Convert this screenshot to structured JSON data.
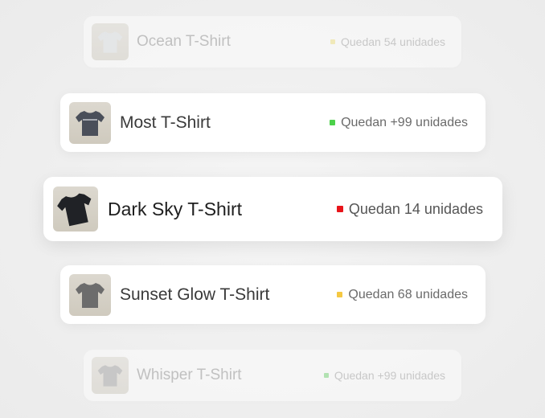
{
  "products": [
    {
      "name": "Ocean T-Shirt",
      "stock_text": "Quedan 54 unidades",
      "status_color": "#f2e27a",
      "shirt_color": "#d9dde0",
      "icon": "t-shirt-icon"
    },
    {
      "name": "Most T-Shirt",
      "stock_text": "Quedan +99 unidades",
      "status_color": "#4cd14a",
      "shirt_color": "#4a4f5a",
      "icon": "t-shirt-icon"
    },
    {
      "name": "Dark Sky T-Shirt",
      "stock_text": "Quedan 14 unidades",
      "status_color": "#e8141a",
      "shirt_color": "#202226",
      "icon": "t-shirt-icon"
    },
    {
      "name": "Sunset Glow T-Shirt",
      "stock_text": "Quedan 68 unidades",
      "status_color": "#f5c842",
      "shirt_color": "#6c6c6c",
      "icon": "t-shirt-icon"
    },
    {
      "name": "Whisper T-Shirt",
      "stock_text": "Quedan +99 unidades",
      "status_color": "#6ad46a",
      "shirt_color": "#9a9a9a",
      "icon": "t-shirt-icon"
    }
  ]
}
